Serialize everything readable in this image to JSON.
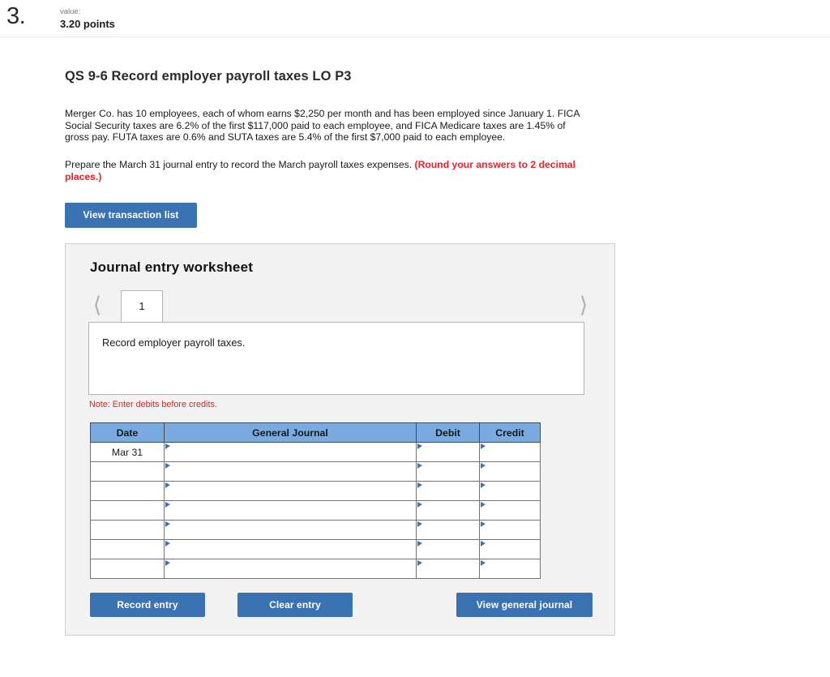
{
  "header": {
    "question_number": "3.",
    "value_label": "value:",
    "points": "3.20 points"
  },
  "question": {
    "title": "QS 9-6 Record employer payroll taxes LO P3",
    "body": "Merger Co. has 10 employees, each of whom earns $2,250 per month and has been employed since January 1. FICA Social Security taxes are 6.2% of the first $117,000 paid to each employee, and FICA Medicare taxes are 1.45% of gross pay. FUTA taxes are 0.6% and SUTA taxes are 5.4% of the first $7,000 paid to each employee.",
    "instruction_plain": "Prepare the March 31 journal entry to record the March payroll taxes expenses. ",
    "instruction_emphasis": "(Round your answers to 2 decimal places.)",
    "view_transaction_list_label": "View transaction list"
  },
  "worksheet": {
    "title": "Journal entry worksheet",
    "prev_icon": "chevron-left-icon",
    "next_icon": "chevron-right-icon",
    "tabs": [
      {
        "label": "1",
        "selected": true
      }
    ],
    "description": "Record employer payroll taxes.",
    "note": "Note: Enter debits before credits.",
    "table": {
      "columns": [
        "Date",
        "General Journal",
        "Debit",
        "Credit"
      ],
      "rows": [
        {
          "date": "Mar 31",
          "general_journal": "",
          "debit": "",
          "credit": ""
        },
        {
          "date": "",
          "general_journal": "",
          "debit": "",
          "credit": ""
        },
        {
          "date": "",
          "general_journal": "",
          "debit": "",
          "credit": ""
        },
        {
          "date": "",
          "general_journal": "",
          "debit": "",
          "credit": ""
        },
        {
          "date": "",
          "general_journal": "",
          "debit": "",
          "credit": ""
        },
        {
          "date": "",
          "general_journal": "",
          "debit": "",
          "credit": ""
        },
        {
          "date": "",
          "general_journal": "",
          "debit": "",
          "credit": ""
        }
      ]
    },
    "actions": {
      "record_entry": "Record entry",
      "clear_entry": "Clear entry",
      "view_general_journal": "View general journal"
    }
  },
  "colors": {
    "button_blue": "#3b72b2",
    "table_header_blue": "#7aabe0",
    "note_red": "#b7302b",
    "emphasis_red": "#ee1c25",
    "panel_gray": "#f2f2f2"
  }
}
